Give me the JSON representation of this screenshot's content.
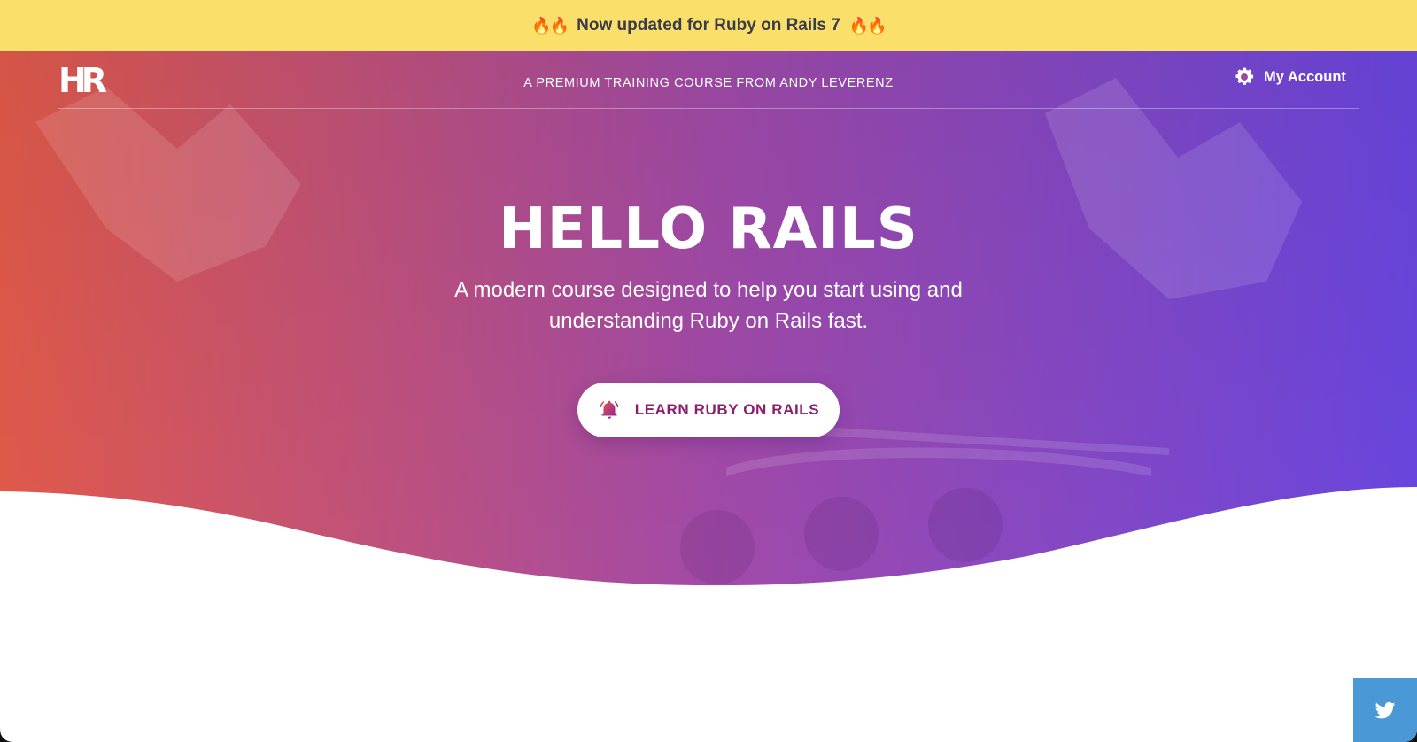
{
  "banner": {
    "text": "Now updated for Ruby on Rails 7",
    "emoji_left": "🔥🔥",
    "emoji_right": "🔥🔥",
    "background": "#fae06b"
  },
  "header": {
    "logo_text": "HR",
    "tagline": "A PREMIUM TRAINING COURSE FROM ANDY LEVERENZ",
    "account_label": "My Account",
    "account_icon": "gear-icon"
  },
  "hero": {
    "title": "HELLO RAILS",
    "subtitle": "A modern course designed to help you start using and understanding Ruby on Rails fast.",
    "cta_label": "LEARN RUBY ON RAILS",
    "cta_icon": "bell-icon",
    "gradient_start": "#e25a4a",
    "gradient_mid": "#a24aa8",
    "gradient_end": "#6a46e0",
    "cta_text_color": "#8b1e6e"
  },
  "floating": {
    "twitter_icon": "twitter-icon",
    "twitter_color": "#4a98d6"
  }
}
